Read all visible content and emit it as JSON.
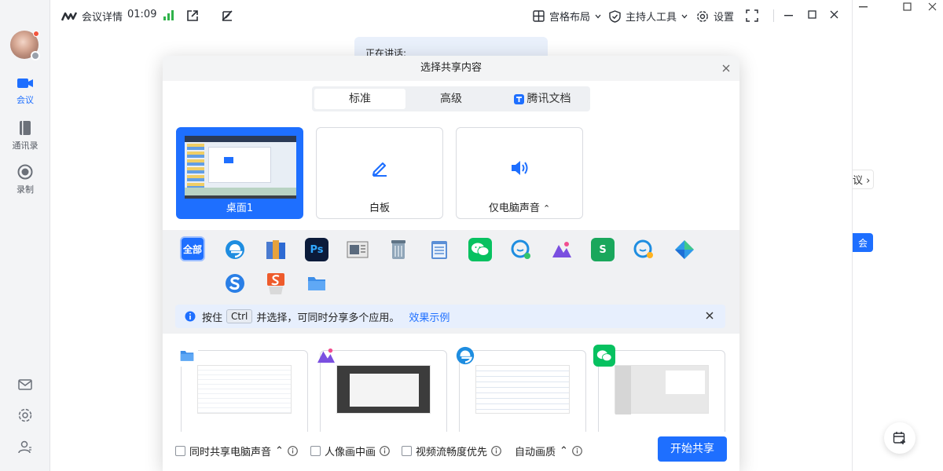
{
  "nav": {
    "items": [
      {
        "label": "会议",
        "active": true
      },
      {
        "label": "通讯录",
        "active": false
      },
      {
        "label": "录制",
        "active": false
      }
    ]
  },
  "topbar": {
    "meeting_details": "会议详情",
    "timer": "01:09",
    "layout_label": "宫格布局",
    "host_tools_label": "主持人工具",
    "settings_label": "设置"
  },
  "speaking": {
    "label": "正在讲话:"
  },
  "right_panel": {
    "text": "议",
    "button": "会"
  },
  "dialog": {
    "title": "选择共享内容",
    "tabs": [
      {
        "label": "标准",
        "selected": true
      },
      {
        "label": "高级",
        "selected": false
      },
      {
        "label": "腾讯文档",
        "selected": false
      }
    ],
    "cards": [
      {
        "label": "桌面1",
        "selected": true
      },
      {
        "label": "白板",
        "selected": false
      },
      {
        "label": "仅电脑声音",
        "selected": false
      }
    ],
    "apps": {
      "all_label": "全部",
      "ps_label": "Ps",
      "s_label": "S"
    },
    "hint": {
      "prefix": "按住",
      "key": "Ctrl",
      "suffix": "并选择，可同时分享多个应用。",
      "link": "效果示例"
    },
    "footer": {
      "share_audio": "同时共享电脑声音",
      "portrait": "人像画中画",
      "smooth": "视频流畅度优先",
      "quality": "自动画质",
      "start": "开始共享"
    }
  },
  "colors": {
    "accent": "#1e6fff",
    "background": "#ffffff",
    "strip": "#f0f1f3"
  }
}
